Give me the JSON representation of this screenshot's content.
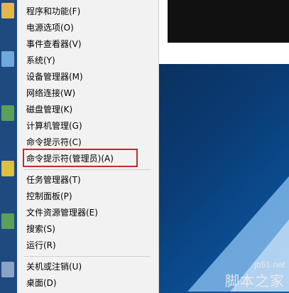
{
  "menu": {
    "groups": [
      [
        {
          "label": "程序和功能(F)"
        },
        {
          "label": "电源选项(O)"
        },
        {
          "label": "事件查看器(V)"
        },
        {
          "label": "系统(Y)"
        },
        {
          "label": "设备管理器(M)"
        },
        {
          "label": "网络连接(W)"
        },
        {
          "label": "磁盘管理(K)"
        },
        {
          "label": "计算机管理(G)"
        },
        {
          "label": "命令提示符(C)"
        },
        {
          "label": "命令提示符(管理员)(A)"
        }
      ],
      [
        {
          "label": "任务管理器(T)"
        },
        {
          "label": "控制面板(P)"
        },
        {
          "label": "文件资源管理器(E)"
        },
        {
          "label": "搜索(S)"
        },
        {
          "label": "运行(R)"
        }
      ],
      [
        {
          "label": "关机或注销(U)"
        },
        {
          "label": "桌面(D)"
        }
      ]
    ],
    "highlighted_item": "命令提示符(管理员)(A)",
    "highlight_color": "#c52b2b"
  },
  "watermark": {
    "line1": "jb51.net",
    "line2": "脚本之家"
  }
}
